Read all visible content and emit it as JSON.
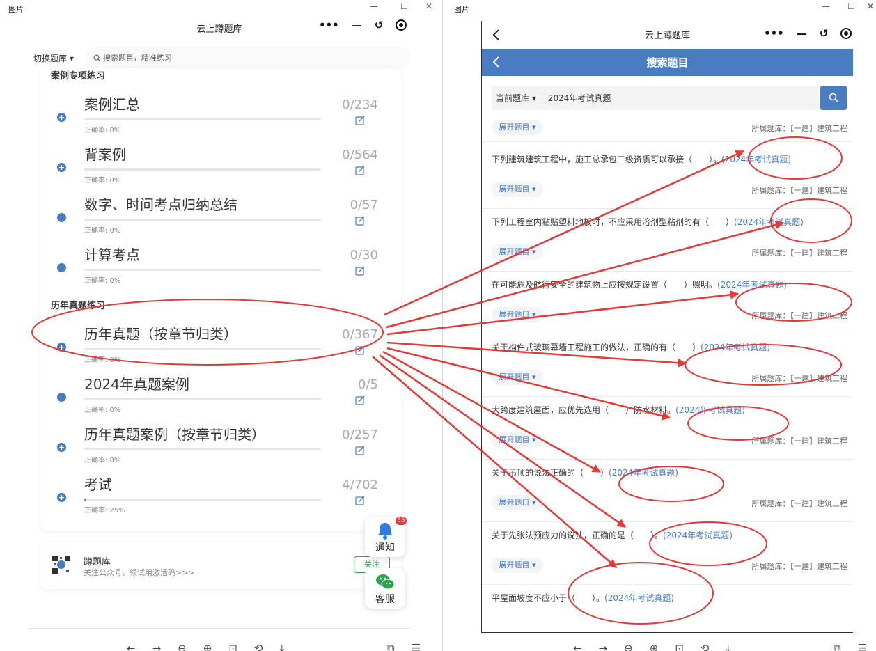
{
  "viewer": {
    "title": "图片",
    "toolbar_left": [
      "←",
      "→",
      "⊖",
      "⊕",
      "⊡",
      "⟲",
      "⤓"
    ],
    "toolbar_right": [
      "⧉",
      "☰"
    ],
    "window_controls": [
      "—",
      "☐",
      "✕"
    ]
  },
  "left_app": {
    "title": "云上蹲题库",
    "capsule": [
      "•••",
      "—",
      "↺"
    ],
    "switch_bank": "切换题库 ▾",
    "search_placeholder": "搜索题目，精准练习",
    "sections": [
      {
        "title": "案例专项练习",
        "items": [
          {
            "name": "案例汇总",
            "rate": "正确率: 0%",
            "count": "0/234",
            "marker": "plus",
            "progress": 0
          },
          {
            "name": "背案例",
            "rate": "正确率: 0%",
            "count": "0/564",
            "marker": "plus",
            "progress": 0
          },
          {
            "name": "数字、时间考点归纳总结",
            "rate": "正确率: 0%",
            "count": "0/57",
            "marker": "dot",
            "progress": 0
          },
          {
            "name": "计算考点",
            "rate": "正确率: 0%",
            "count": "0/30",
            "marker": "dot",
            "progress": 0
          }
        ]
      },
      {
        "title": "历年真题练习",
        "items": [
          {
            "name": "历年真题（按章节归类）",
            "rate": "正确率: 0%",
            "count": "0/367",
            "marker": "plus",
            "progress": 0
          },
          {
            "name": "2024年真题案例",
            "rate": "正确率: 0%",
            "count": "0/5",
            "marker": "dot",
            "progress": 0
          },
          {
            "name": "历年真题案例（按章节归类）",
            "rate": "正确率: 0%",
            "count": "0/257",
            "marker": "plus",
            "progress": 0
          },
          {
            "name": "考试",
            "rate": "正确率: 25%",
            "count": "4/702",
            "marker": "plus",
            "progress": 0.006
          }
        ]
      }
    ],
    "follow": {
      "name": "蹲题库",
      "desc": "关注公众号，领试用激活码>>>",
      "button": "关注"
    },
    "notify": {
      "label": "通知",
      "badge": "55"
    },
    "service": {
      "label": "客服"
    },
    "accent": "#4a7cc2"
  },
  "right_app": {
    "title": "云上蹲题库",
    "page_title": "搜索题目",
    "scope": "当前题库 ▾",
    "keyword": "2024年考试真题",
    "expand_label": "展开题目 ▾",
    "bank_label": "所属题库：【一建】建筑工程",
    "questions": [
      {
        "text": "下列建筑建筑工程中，施工总承包二级资质可以承接（　　）。",
        "tag": "(2024年考试真题)"
      },
      {
        "text": "下列工程室内粘贴塑料地板时，不应采用溶剂型粘剂的有（　　）",
        "tag": "(2024年考试真题)"
      },
      {
        "text": "在可能危及航行安全的建筑物上应按规定设置（　　）照明。",
        "tag": "(2024年考试真题)"
      },
      {
        "text": "关于构件式玻璃幕墙工程施工的做法，正确的有（　　）",
        "tag": "(2024年考试真题)"
      },
      {
        "text": "大跨度建筑屋面，应优先选用（　　）防水材料。",
        "tag": "(2024年考试真题)"
      },
      {
        "text": "关于吊顶的说法正确的（　　）",
        "tag": "(2024年考试真题)"
      },
      {
        "text": "关于先张法预应力的说法，正确的是（　　）。",
        "tag": "(2024年考试真题)"
      },
      {
        "text": "平屋面坡度不应小于（　　）。",
        "tag": "(2024年考试真题)"
      }
    ],
    "accent": "#4a7cc2"
  },
  "annotation_color": "#e53935"
}
